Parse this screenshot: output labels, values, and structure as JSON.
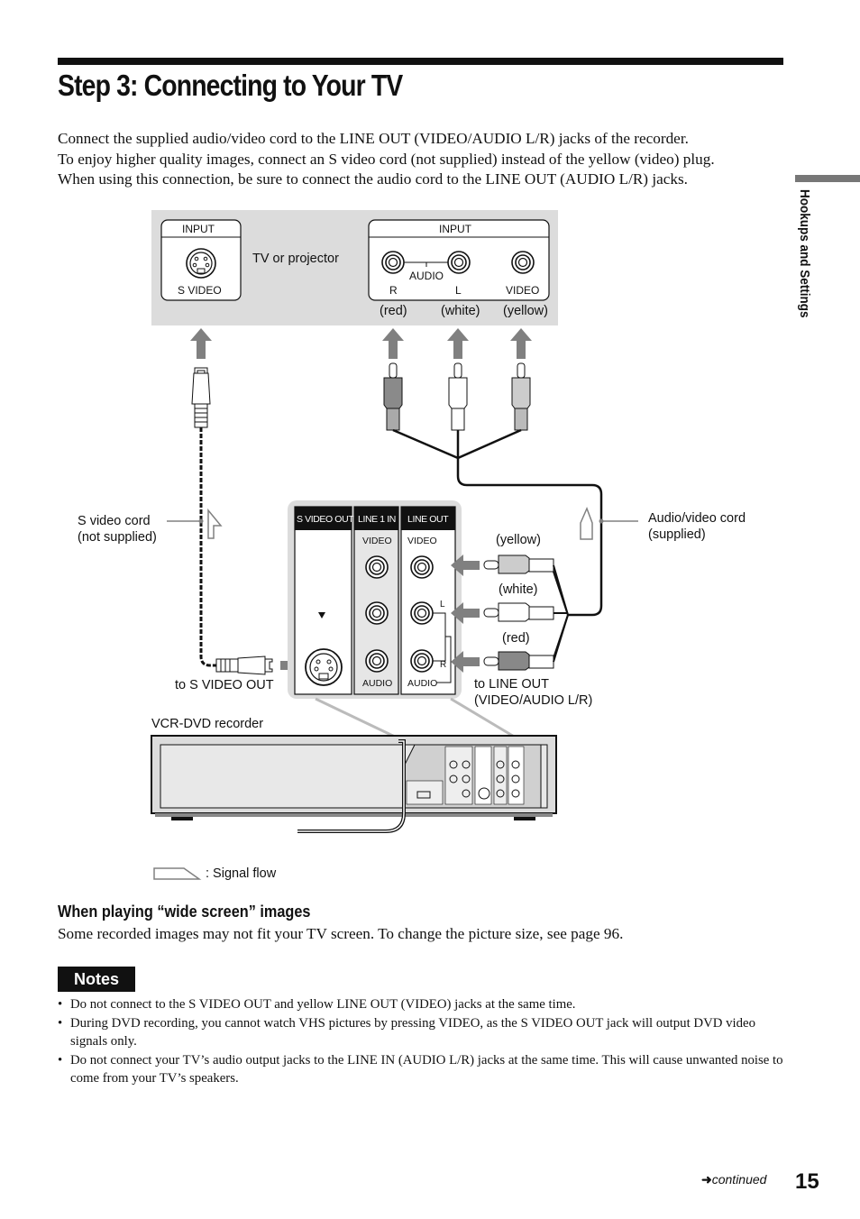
{
  "page": {
    "title": "Step 3: Connecting to Your TV",
    "intro_lines": [
      "Connect the supplied audio/video cord to the LINE OUT (VIDEO/AUDIO L/R) jacks of the recorder.",
      "To enjoy higher quality images, connect an S video cord (not supplied) instead of the yellow (video) plug.",
      "When using this connection, be sure to connect the audio cord to the LINE OUT (AUDIO L/R) jacks."
    ],
    "side_tab": "Hookups and Settings",
    "page_number": "15",
    "continued": "continued"
  },
  "diagram": {
    "tv": {
      "label": "TV or projector",
      "svideo_box": {
        "header": "INPUT",
        "jack_label": "S VIDEO"
      },
      "av_box": {
        "header": "INPUT",
        "audio_label": "AUDIO",
        "r_label": "R",
        "l_label": "L",
        "video_label": "VIDEO"
      },
      "colors": {
        "red": "(red)",
        "white": "(white)",
        "yellow": "(yellow)"
      }
    },
    "svideo_cord": {
      "label_line1": "S video cord",
      "label_line2": "(not supplied)",
      "to_label": "to S VIDEO OUT"
    },
    "av_cord": {
      "label_line1": "Audio/video cord",
      "label_line2": "(supplied)",
      "to_line1": "to LINE OUT",
      "to_line2": "(VIDEO/AUDIO L/R)"
    },
    "plug_colors": {
      "yellow": "(yellow)",
      "white": "(white)",
      "red": "(red)"
    },
    "panel": {
      "svideo_out": "S VIDEO OUT",
      "line1_in": "LINE 1 IN",
      "line_out": "LINE OUT",
      "video": "VIDEO",
      "audio": "AUDIO",
      "l": "L",
      "r": "R"
    },
    "recorder_label": "VCR-DVD recorder",
    "legend": ": Signal flow"
  },
  "wide_screen": {
    "heading": "When playing “wide screen” images",
    "text": "Some recorded images may not fit your TV screen. To change the picture size, see page 96."
  },
  "notes": {
    "badge": "Notes",
    "items": [
      "Do not connect to the S VIDEO OUT and yellow LINE OUT (VIDEO) jacks at the same time.",
      "During DVD recording, you cannot watch VHS pictures by pressing VIDEO, as the S VIDEO OUT jack will output DVD video signals only.",
      "Do not connect your TV’s audio output jacks to the LINE IN (AUDIO L/R) jacks at the same time. This will cause unwanted noise to come from your TV’s speakers."
    ]
  },
  "colors": {
    "panel_gray": "#dcdcdc",
    "arrow_gray": "#808080",
    "text_black": "#111111"
  }
}
